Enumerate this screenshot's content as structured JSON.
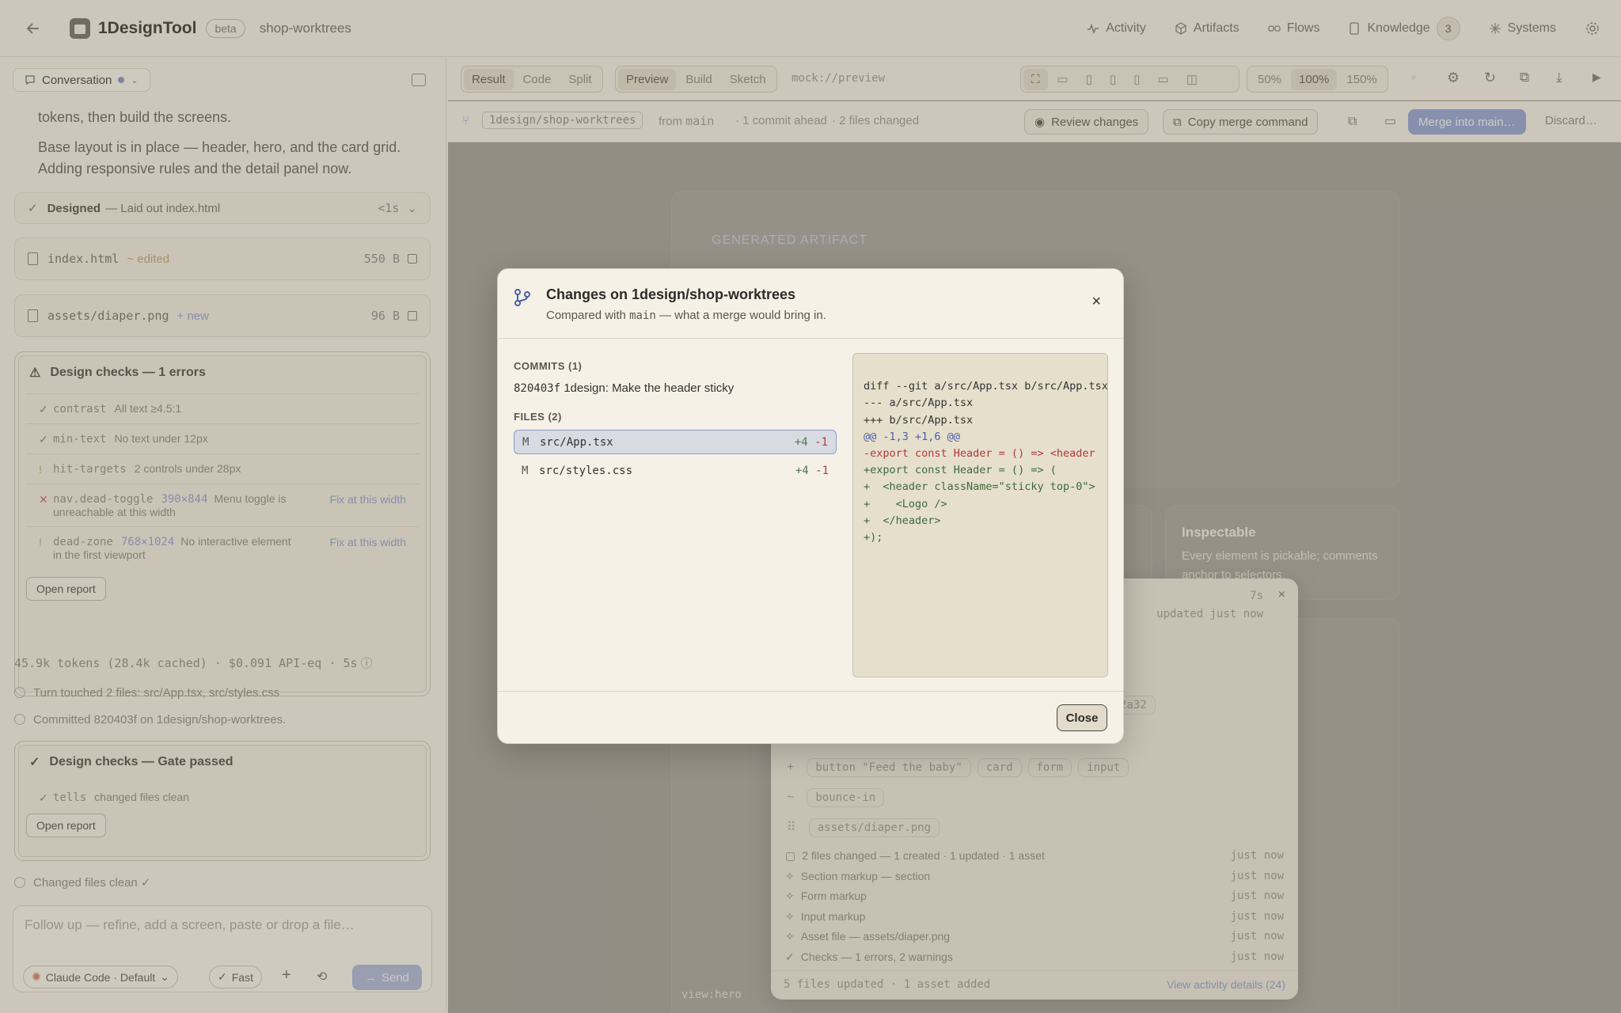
{
  "topbar": {
    "app_name": "1DesignTool",
    "beta": "beta",
    "project": "shop-worktrees",
    "nav": [
      "Activity",
      "Artifacts",
      "Flows",
      "Knowledge",
      "Systems"
    ],
    "knowledge_count": "3"
  },
  "left": {
    "conversation_label": "Conversation",
    "msg_top": "tokens, then build the screens.",
    "msg_line1": "Base layout is in place — header, hero, and the card grid.",
    "msg_line2": "Adding responsive rules and the detail panel now.",
    "designed": {
      "label": "Designed",
      "detail": "— Laid out index.html",
      "time": "<1s"
    },
    "file1": {
      "name": "index.html",
      "status": "~ edited",
      "size": "550 B"
    },
    "file2": {
      "name": "assets/diaper.png",
      "status": "+ new",
      "size": "96 B"
    },
    "checks1": {
      "title": "Design checks — 1 errors",
      "items": [
        {
          "mark": "✓",
          "name": "contrast",
          "text": "All text ≥4.5:1",
          "fix": ""
        },
        {
          "mark": "✓",
          "name": "min-text",
          "text": "No text under 12px",
          "fix": ""
        },
        {
          "mark": "!",
          "name": "hit-targets",
          "text": "2 controls under 28px",
          "fix": ""
        },
        {
          "mark": "✕",
          "name": "nav.dead-toggle",
          "size": "390×844",
          "text": "Menu toggle is unreachable at this width",
          "fix": "Fix at this width"
        },
        {
          "mark": "!",
          "name": "dead-zone",
          "size": "768×1024",
          "text": "No interactive element in the first viewport",
          "fix": "Fix at this width"
        }
      ],
      "open": "Open report"
    },
    "tokens": "45.9k tokens (28.4k cached) · $0.091 API-eq · 5s",
    "turn": "Turn touched 2 files: src/App.tsx, src/styles.css",
    "committed": "Committed 820403f on 1design/shop-worktrees.",
    "checks2": {
      "title": "Design checks — Gate passed",
      "item": {
        "mark": "✓",
        "name": "tells",
        "text": "changed files clean"
      },
      "open": "Open report"
    },
    "changed": "Changed files clean ✓",
    "composer": {
      "placeholder": "Follow up — refine, add a screen, paste or drop a file…",
      "model": "Claude Code · Default",
      "fast": "Fast",
      "send": "Send"
    }
  },
  "toolbar": {
    "view_tabs": [
      "Result",
      "Code",
      "Split"
    ],
    "mode_tabs": [
      "Preview",
      "Build",
      "Sketch"
    ],
    "url": "mock://preview",
    "zoom": [
      "50%",
      "100%",
      "150%"
    ],
    "branch": "1design/shop-worktrees",
    "from": "from",
    "base": "main",
    "ahead": "1 commit ahead",
    "files_changed": "2 files changed",
    "review": "Review changes",
    "copy_merge": "Copy merge command",
    "merge": "Merge into main…",
    "discard": "Discard…"
  },
  "canvas": {
    "eyebrow": "GENERATED ARTIFACT",
    "card_title": "Inspectable",
    "card_text": "Every element is pickable; comments anchor to selectors.",
    "footer_tag": "view:hero"
  },
  "activity": {
    "time": "7s",
    "updated": "updated just now",
    "chip_partial": "2a32",
    "chips_added": [
      "button \"Feed the baby\"",
      "card",
      "form",
      "input"
    ],
    "chips_changed": [
      "bounce-in"
    ],
    "chips_assets": [
      "assets/diaper.png"
    ],
    "log": [
      {
        "text": "2 files changed — 1 created · 1 updated · 1 asset",
        "time": "just now"
      },
      {
        "text": "Section markup — section",
        "time": "just now"
      },
      {
        "text": "Form markup",
        "time": "just now"
      },
      {
        "text": "Input markup",
        "time": "just now"
      },
      {
        "text": "Asset file — assets/diaper.png",
        "time": "just now"
      },
      {
        "text": "Checks — 1 errors, 2 warnings",
        "time": "just now"
      }
    ],
    "footer": "5 files updated · 1 asset added",
    "details": "View activity details (24)"
  },
  "modal": {
    "title": "Changes on 1design/shop-worktrees",
    "sub_pre": "Compared with",
    "sub_base": "main",
    "sub_post": "— what a merge would bring in.",
    "commits_header": "COMMITS (1)",
    "commit_hash": "820403f",
    "commit_msg": "1design: Make the header sticky",
    "files_header": "FILES (2)",
    "files": [
      {
        "status": "M",
        "path": "src/App.tsx",
        "add": "+4",
        "del": "-1"
      },
      {
        "status": "M",
        "path": "src/styles.css",
        "add": "+4",
        "del": "-1"
      }
    ],
    "diff": [
      {
        "kind": "meta",
        "text": "diff --git a/src/App.tsx b/src/App.tsx"
      },
      {
        "kind": "meta",
        "text": "--- a/src/App.tsx"
      },
      {
        "kind": "meta",
        "text": "+++ b/src/App.tsx"
      },
      {
        "kind": "hunk",
        "text": "@@ -1,3 +1,6 @@"
      },
      {
        "kind": "del",
        "text": "-export const Header = () => <header"
      },
      {
        "kind": "add",
        "text": "+export const Header = () => ("
      },
      {
        "kind": "add",
        "text": "+  <header className=\"sticky top-0\">"
      },
      {
        "kind": "add",
        "text": "+    <Logo />"
      },
      {
        "kind": "add",
        "text": "+  </header>"
      },
      {
        "kind": "add",
        "text": "+);"
      }
    ],
    "close": "Close"
  },
  "colors": {
    "accent": "#7d90c4",
    "add": "#3d6b3d",
    "del": "#b03a3a",
    "hunk": "#4a5fa8"
  }
}
